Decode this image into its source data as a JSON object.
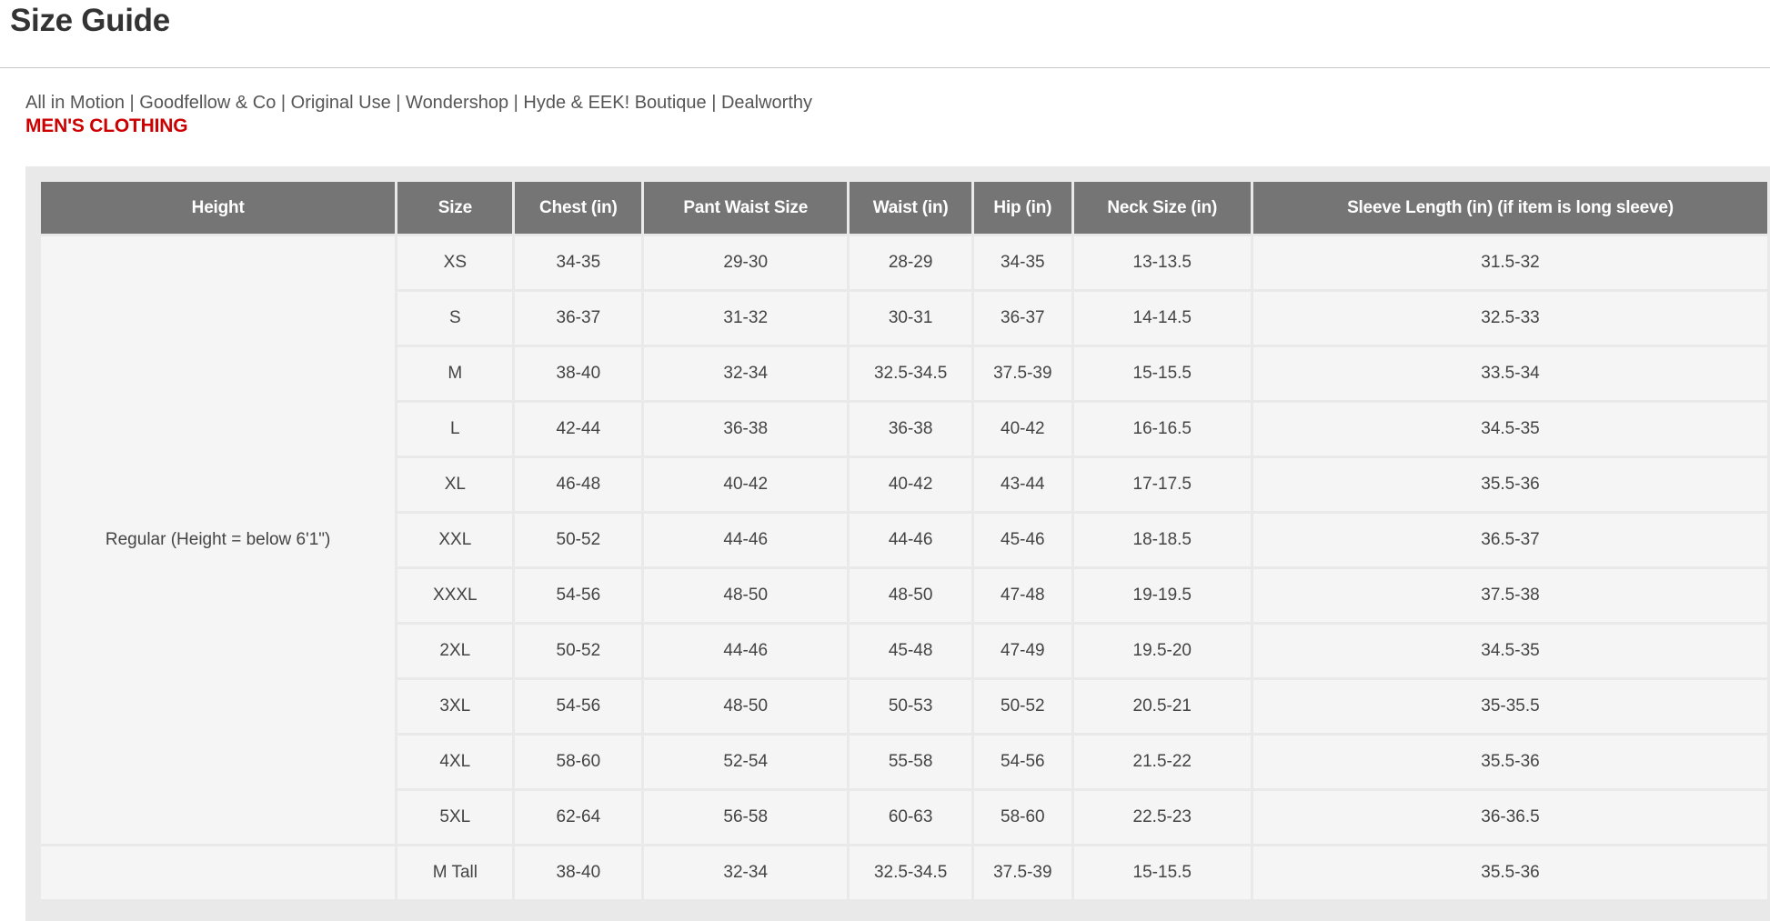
{
  "page": {
    "title": "Size Guide"
  },
  "brands": [
    "All in Motion",
    "Goodfellow & Co",
    "Original Use",
    "Wondershop",
    "Hyde & EEK! Boutique",
    "Dealworthy"
  ],
  "brand_separator": "|",
  "section": {
    "heading": "MEN'S CLOTHING"
  },
  "table": {
    "headers": [
      "Height",
      "Size",
      "Chest (in)",
      "Pant Waist Size",
      "Waist (in)",
      "Hip (in)",
      "Neck Size (in)",
      "Sleeve Length (in) (if item is long sleeve)"
    ],
    "groups": [
      {
        "height": "Regular (Height = below 6'1\")",
        "rows": [
          [
            "XS",
            "34-35",
            "29-30",
            "28-29",
            "34-35",
            "13-13.5",
            "31.5-32"
          ],
          [
            "S",
            "36-37",
            "31-32",
            "30-31",
            "36-37",
            "14-14.5",
            "32.5-33"
          ],
          [
            "M",
            "38-40",
            "32-34",
            "32.5-34.5",
            "37.5-39",
            "15-15.5",
            "33.5-34"
          ],
          [
            "L",
            "42-44",
            "36-38",
            "36-38",
            "40-42",
            "16-16.5",
            "34.5-35"
          ],
          [
            "XL",
            "46-48",
            "40-42",
            "40-42",
            "43-44",
            "17-17.5",
            "35.5-36"
          ],
          [
            "XXL",
            "50-52",
            "44-46",
            "44-46",
            "45-46",
            "18-18.5",
            "36.5-37"
          ],
          [
            "XXXL",
            "54-56",
            "48-50",
            "48-50",
            "47-48",
            "19-19.5",
            "37.5-38"
          ],
          [
            "2XL",
            "50-52",
            "44-46",
            "45-48",
            "47-49",
            "19.5-20",
            "34.5-35"
          ],
          [
            "3XL",
            "54-56",
            "48-50",
            "50-53",
            "50-52",
            "20.5-21",
            "35-35.5"
          ],
          [
            "4XL",
            "58-60",
            "52-54",
            "55-58",
            "54-56",
            "21.5-22",
            "35.5-36"
          ],
          [
            "5XL",
            "62-64",
            "56-58",
            "60-63",
            "58-60",
            "22.5-23",
            "36-36.5"
          ]
        ]
      },
      {
        "height": "",
        "rows": [
          [
            "M Tall",
            "38-40",
            "32-34",
            "32.5-34.5",
            "37.5-39",
            "15-15.5",
            "35.5-36"
          ]
        ]
      }
    ]
  }
}
